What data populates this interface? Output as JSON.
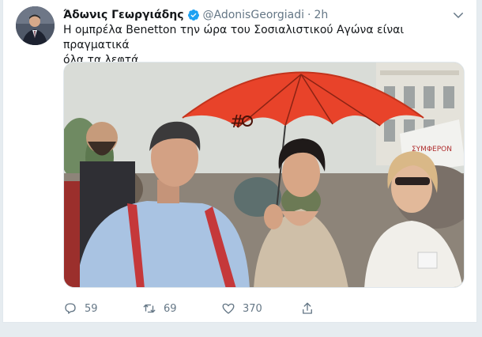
{
  "tweet": {
    "author_name": "Άδωνις Γεωργιάδης",
    "handle": "@AdonisGeorgiadi",
    "separator": "·",
    "time": "2h",
    "text": "Η ομπρέλα Benetton την ώρα του Σοσιαλιστικού Αγώνα είναι πραγματικά\nόλα τα λεφτά....",
    "photo": {
      "description_icon": "photo-umbrella-protest",
      "umbrella_color": "#e8432a"
    },
    "actions": {
      "reply_count": "59",
      "retweet_count": "69",
      "like_count": "370"
    }
  },
  "colors": {
    "link_blue": "#1da1f2",
    "text": "#14171a",
    "muted": "#657786"
  }
}
